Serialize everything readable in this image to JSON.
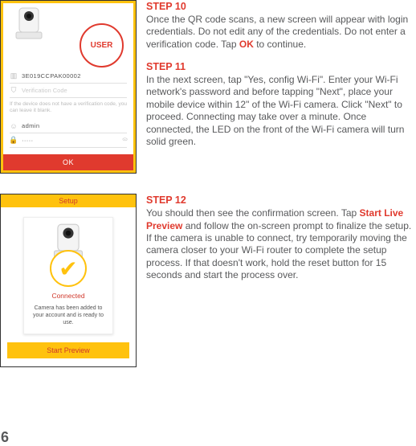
{
  "phone1": {
    "userBadge": "USER",
    "serial": "3E019CCPAK00002",
    "verificationPlaceholder": "Verification Code",
    "hint": "If the device does not have a verification code, you can leave it blank.",
    "username": "admin",
    "passwordMask": "·····",
    "eye": "ᯣ",
    "okLabel": "OK"
  },
  "phone2": {
    "header": "Setup",
    "check": "✔",
    "connected": "Connected",
    "readyText": "Camera has been added to your account and is ready to use.",
    "startLabel": "Start Preview"
  },
  "steps": {
    "s10": {
      "title": "STEP 10",
      "body_a": "Once the QR code scans, a new screen will appear with login credentials. Do not edit any of the credentials. Do not enter a verification code. Tap ",
      "ok": "OK",
      "body_b": " to continue."
    },
    "s11": {
      "title": "STEP 11",
      "body": "In the next screen, tap \"Yes, config Wi-Fi\". Enter your Wi-Fi network's password and before tapping \"Next\", place your mobile device within 12\" of the Wi-Fi camera. Click \"Next\" to proceed. Connecting may take over a minute. Once connected, the LED on the front of the Wi-Fi camera will turn solid green."
    },
    "s12": {
      "title": "STEP 12",
      "body_a": "You should then see the confirmation screen. Tap ",
      "start": "Start Live Preview",
      "body_b": " and follow the on-screen prompt to finalize the setup. If the camera is unable to connect, try temporarily moving the camera closer to your Wi-Fi router to complete the setup process. If that doesn't work, hold the reset button for 15 seconds and start the process over."
    }
  },
  "pageNumber": "6"
}
